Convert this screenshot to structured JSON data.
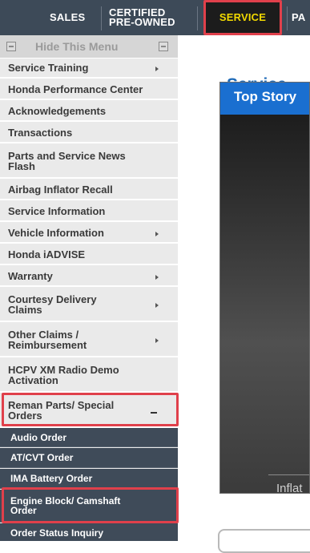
{
  "topnav": {
    "sales": "SALES",
    "certified_line1": "CERTIFIED",
    "certified_line2": "PRE-OWNED",
    "service": "SERVICE",
    "parts_partial": "PA"
  },
  "sidebar": {
    "hide_label": "Hide This Menu",
    "items": [
      {
        "label": "Service Training",
        "has_arrow": true
      },
      {
        "label": "Honda Performance Center",
        "has_arrow": false
      },
      {
        "label": "Acknowledgements",
        "has_arrow": false
      },
      {
        "label": "Transactions",
        "has_arrow": false
      },
      {
        "label": "Parts and Service News Flash",
        "has_arrow": false
      },
      {
        "label": "Airbag Inflator Recall",
        "has_arrow": false
      },
      {
        "label": "Service Information",
        "has_arrow": false
      },
      {
        "label": "Vehicle Information",
        "has_arrow": true
      },
      {
        "label": "Honda iADVISE",
        "has_arrow": false
      },
      {
        "label": "Warranty",
        "has_arrow": true
      },
      {
        "label": "Courtesy Delivery Claims",
        "has_arrow": true
      },
      {
        "label": "Other Claims / Reimbursement",
        "has_arrow": true
      },
      {
        "label": "HCPV XM Radio Demo Activation",
        "has_arrow": false
      },
      {
        "label": "Reman Parts/ Special Orders",
        "expanded": true
      }
    ],
    "subitems": [
      {
        "label": "Audio Order"
      },
      {
        "label": "AT/CVT Order"
      },
      {
        "label": "IMA Battery Order"
      },
      {
        "label": "Engine Block/ Camshaft Order"
      },
      {
        "label": "Order Status Inquiry"
      }
    ]
  },
  "main": {
    "title": "Service",
    "top_story": "Top Story",
    "caption_partial": "Inflat"
  },
  "colors": {
    "nav_bg": "#3d4a58",
    "service_active": "#f2d900",
    "highlight": "#e0404b",
    "submenu_bg": "#3f4b59",
    "title_blue": "#1f6bb8",
    "story_blue": "#1a6fd0"
  }
}
